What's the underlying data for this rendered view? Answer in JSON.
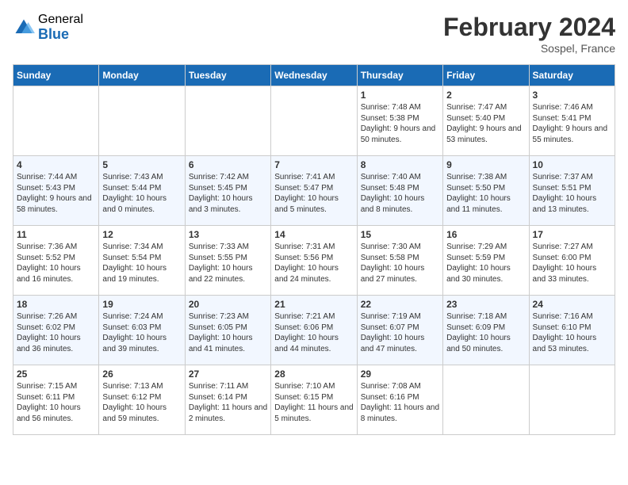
{
  "header": {
    "logo_general": "General",
    "logo_blue": "Blue",
    "month_title": "February 2024",
    "location": "Sospel, France"
  },
  "days_of_week": [
    "Sunday",
    "Monday",
    "Tuesday",
    "Wednesday",
    "Thursday",
    "Friday",
    "Saturday"
  ],
  "weeks": [
    [
      {
        "day": "",
        "info": ""
      },
      {
        "day": "",
        "info": ""
      },
      {
        "day": "",
        "info": ""
      },
      {
        "day": "",
        "info": ""
      },
      {
        "day": "1",
        "info": "Sunrise: 7:48 AM\nSunset: 5:38 PM\nDaylight: 9 hours\nand 50 minutes."
      },
      {
        "day": "2",
        "info": "Sunrise: 7:47 AM\nSunset: 5:40 PM\nDaylight: 9 hours\nand 53 minutes."
      },
      {
        "day": "3",
        "info": "Sunrise: 7:46 AM\nSunset: 5:41 PM\nDaylight: 9 hours\nand 55 minutes."
      }
    ],
    [
      {
        "day": "4",
        "info": "Sunrise: 7:44 AM\nSunset: 5:43 PM\nDaylight: 9 hours\nand 58 minutes."
      },
      {
        "day": "5",
        "info": "Sunrise: 7:43 AM\nSunset: 5:44 PM\nDaylight: 10 hours\nand 0 minutes."
      },
      {
        "day": "6",
        "info": "Sunrise: 7:42 AM\nSunset: 5:45 PM\nDaylight: 10 hours\nand 3 minutes."
      },
      {
        "day": "7",
        "info": "Sunrise: 7:41 AM\nSunset: 5:47 PM\nDaylight: 10 hours\nand 5 minutes."
      },
      {
        "day": "8",
        "info": "Sunrise: 7:40 AM\nSunset: 5:48 PM\nDaylight: 10 hours\nand 8 minutes."
      },
      {
        "day": "9",
        "info": "Sunrise: 7:38 AM\nSunset: 5:50 PM\nDaylight: 10 hours\nand 11 minutes."
      },
      {
        "day": "10",
        "info": "Sunrise: 7:37 AM\nSunset: 5:51 PM\nDaylight: 10 hours\nand 13 minutes."
      }
    ],
    [
      {
        "day": "11",
        "info": "Sunrise: 7:36 AM\nSunset: 5:52 PM\nDaylight: 10 hours\nand 16 minutes."
      },
      {
        "day": "12",
        "info": "Sunrise: 7:34 AM\nSunset: 5:54 PM\nDaylight: 10 hours\nand 19 minutes."
      },
      {
        "day": "13",
        "info": "Sunrise: 7:33 AM\nSunset: 5:55 PM\nDaylight: 10 hours\nand 22 minutes."
      },
      {
        "day": "14",
        "info": "Sunrise: 7:31 AM\nSunset: 5:56 PM\nDaylight: 10 hours\nand 24 minutes."
      },
      {
        "day": "15",
        "info": "Sunrise: 7:30 AM\nSunset: 5:58 PM\nDaylight: 10 hours\nand 27 minutes."
      },
      {
        "day": "16",
        "info": "Sunrise: 7:29 AM\nSunset: 5:59 PM\nDaylight: 10 hours\nand 30 minutes."
      },
      {
        "day": "17",
        "info": "Sunrise: 7:27 AM\nSunset: 6:00 PM\nDaylight: 10 hours\nand 33 minutes."
      }
    ],
    [
      {
        "day": "18",
        "info": "Sunrise: 7:26 AM\nSunset: 6:02 PM\nDaylight: 10 hours\nand 36 minutes."
      },
      {
        "day": "19",
        "info": "Sunrise: 7:24 AM\nSunset: 6:03 PM\nDaylight: 10 hours\nand 39 minutes."
      },
      {
        "day": "20",
        "info": "Sunrise: 7:23 AM\nSunset: 6:05 PM\nDaylight: 10 hours\nand 41 minutes."
      },
      {
        "day": "21",
        "info": "Sunrise: 7:21 AM\nSunset: 6:06 PM\nDaylight: 10 hours\nand 44 minutes."
      },
      {
        "day": "22",
        "info": "Sunrise: 7:19 AM\nSunset: 6:07 PM\nDaylight: 10 hours\nand 47 minutes."
      },
      {
        "day": "23",
        "info": "Sunrise: 7:18 AM\nSunset: 6:09 PM\nDaylight: 10 hours\nand 50 minutes."
      },
      {
        "day": "24",
        "info": "Sunrise: 7:16 AM\nSunset: 6:10 PM\nDaylight: 10 hours\nand 53 minutes."
      }
    ],
    [
      {
        "day": "25",
        "info": "Sunrise: 7:15 AM\nSunset: 6:11 PM\nDaylight: 10 hours\nand 56 minutes."
      },
      {
        "day": "26",
        "info": "Sunrise: 7:13 AM\nSunset: 6:12 PM\nDaylight: 10 hours\nand 59 minutes."
      },
      {
        "day": "27",
        "info": "Sunrise: 7:11 AM\nSunset: 6:14 PM\nDaylight: 11 hours\nand 2 minutes."
      },
      {
        "day": "28",
        "info": "Sunrise: 7:10 AM\nSunset: 6:15 PM\nDaylight: 11 hours\nand 5 minutes."
      },
      {
        "day": "29",
        "info": "Sunrise: 7:08 AM\nSunset: 6:16 PM\nDaylight: 11 hours\nand 8 minutes."
      },
      {
        "day": "",
        "info": ""
      },
      {
        "day": "",
        "info": ""
      }
    ]
  ]
}
